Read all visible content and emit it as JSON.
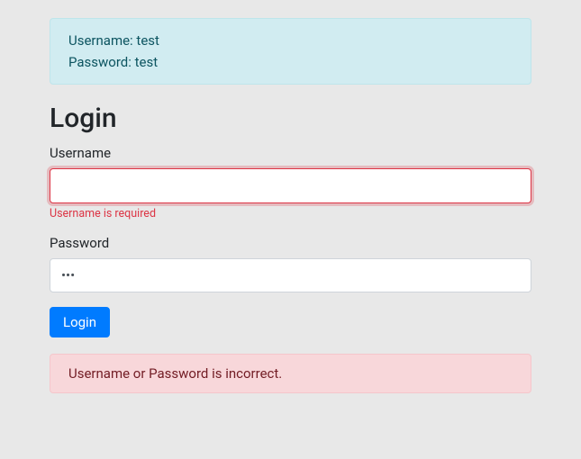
{
  "hint": {
    "username_line": "Username: test",
    "password_line": "Password: test"
  },
  "heading": "Login",
  "form": {
    "username": {
      "label": "Username",
      "value": "",
      "error": "Username is required"
    },
    "password": {
      "label": "Password",
      "value": "•••"
    },
    "submit_label": "Login"
  },
  "error_message": "Username or Password is incorrect."
}
